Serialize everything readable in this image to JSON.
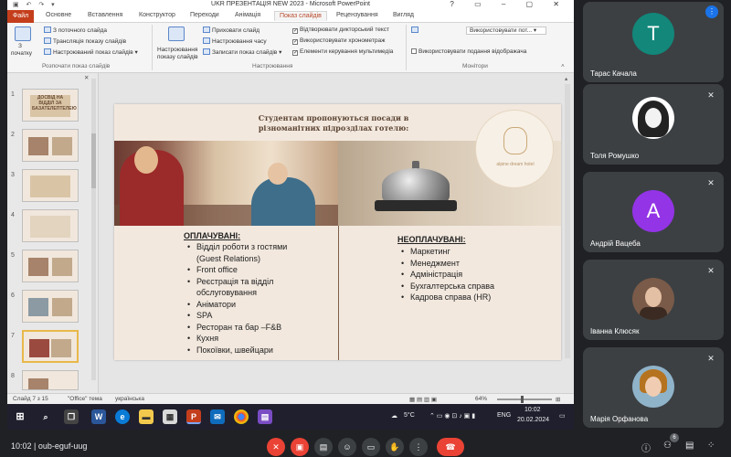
{
  "powerpoint": {
    "window_title": "UKR ПРЕЗЕНТАЦІЯ NEW 2023 - Microsoft PowerPoint",
    "tabs": [
      "Файл",
      "Основне",
      "Вставлення",
      "Конструктор",
      "Переходи",
      "Анімація",
      "Показ слайдів",
      "Рецензування",
      "Вигляд"
    ],
    "ribbon": {
      "start_show_big_label_1": "З",
      "start_show_big_label_2": "початку",
      "from_current": "З поточного слайда",
      "broadcast": "Трансляція показу слайдів",
      "custom_show": "Настроюваний показ слайдів",
      "group_start": "Розпочати показ слайдів",
      "setup_big_label_1": "Настроювання",
      "setup_big_label_2": "показу слайдів",
      "hide_slide": "Приховати слайд",
      "rehearse_timings": "Настроювання часу",
      "record_show": "Записати показ слайдів",
      "play_narrations": "Відтворювати дикторський текст",
      "use_timings": "Використовувати хронометраж",
      "show_media_controls": "Елементи керування мультимедіа",
      "group_setup": "Настроювання",
      "monitor_dropdown": "Використовувати пот...",
      "presenter_view": "Використовувати подання відображача",
      "group_monitors": "Монітори"
    },
    "slide": {
      "header_line1": "Студентам пропонуються посади в",
      "header_line2": "різноманітних підрозділах готелю:",
      "logo_text": "alpine dream hotel",
      "left_heading": "ОПЛАЧУВАНІ:",
      "left_items": [
        "Відділ роботи з гостями",
        "(Guest Relations)",
        "Front office",
        "Реєстрація та відділ",
        "обслуговування",
        "Аніматори",
        "SPA",
        "Ресторан та бар –F&B",
        "Кухня",
        "Покоївки, швейцари"
      ],
      "right_heading": "НЕОПЛАЧУВАНІ:",
      "right_items": [
        "Маркетинг",
        "Менеджмент",
        "Адміністрація",
        "Бухгалтерська справа",
        "Кадрова справа (HR)"
      ]
    },
    "thumb_numbers": [
      "1",
      "2",
      "3",
      "4",
      "5",
      "6",
      "7",
      "8"
    ],
    "thumb1_text": "ДОСВІД НА ВІДДІЛ ЗА БАЗАТЕЛЕПТЕЛЕЮ",
    "status": {
      "slide_count": "Слайд 7 з 15",
      "theme": "\"Office\" тема",
      "language": "українська",
      "zoom": "64%"
    },
    "taskbar": {
      "weather": "5°C",
      "lang": "ENG",
      "time": "10:02",
      "date": "20.02.2024"
    }
  },
  "participants": [
    {
      "name": "Тарас Качала",
      "initial": "T",
      "color": "#12877a"
    },
    {
      "name": "Толя Ромушко"
    },
    {
      "name": "Андрій Вацеба",
      "initial": "A",
      "color": "#9334e6"
    },
    {
      "name": "Іванна Клюсяк"
    },
    {
      "name": "Марія Орфанова"
    }
  ],
  "meeting": {
    "clock": "10:02",
    "code": "oub-eguf-uug",
    "participant_count": "6"
  },
  "colors": {
    "accent_file_tab": "#c43e1c",
    "meet_red": "#ea4335",
    "meet_blue": "#1a73e8"
  }
}
